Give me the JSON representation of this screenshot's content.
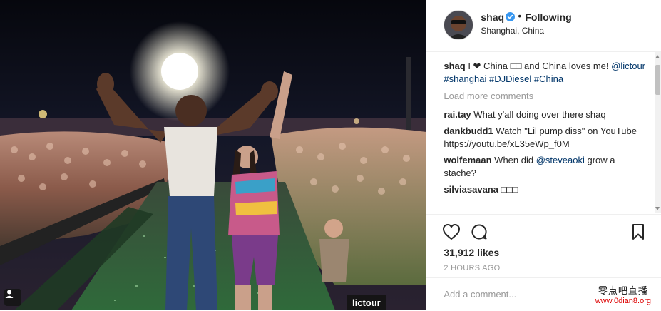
{
  "post": {
    "username": "shaq",
    "follow_label": "Following",
    "location": "Shanghai, China",
    "photo_tag": "lictour"
  },
  "caption": {
    "username": "shaq",
    "text_a": "I ❤ China",
    "text_b": "□□",
    "text_c": "and China loves me!",
    "tags": [
      "@lictour",
      "#shanghai",
      "#DJDiesel",
      "#China"
    ]
  },
  "load_more": "Load more comments",
  "comments": [
    {
      "user": "rai.tay",
      "text": "What y'all doing over there shaq"
    },
    {
      "user": "dankbudd1",
      "text": "Watch \"Lil pump diss\" on YouTube https://youtu.be/xL35eWp_f0M"
    },
    {
      "user": "wolfemaan",
      "text_a": "When did",
      "mention": "@steveaoki",
      "text_b": "grow a stache?"
    },
    {
      "user": "silviasavana",
      "text": "□□□"
    }
  ],
  "likes": "31,912 likes",
  "time": "2 HOURS AGO",
  "add_comment_placeholder": "Add a comment...",
  "watermark": {
    "line1": "零点吧直播",
    "line2": "www.0dian8.org"
  },
  "icons": [
    "verified-icon",
    "heart-icon",
    "comment-icon",
    "bookmark-icon",
    "user-tag-icon"
  ],
  "colors": {
    "link": "#003569",
    "verified": "#3897f0",
    "muted": "#999999",
    "watermark_url": "#dd0000"
  }
}
